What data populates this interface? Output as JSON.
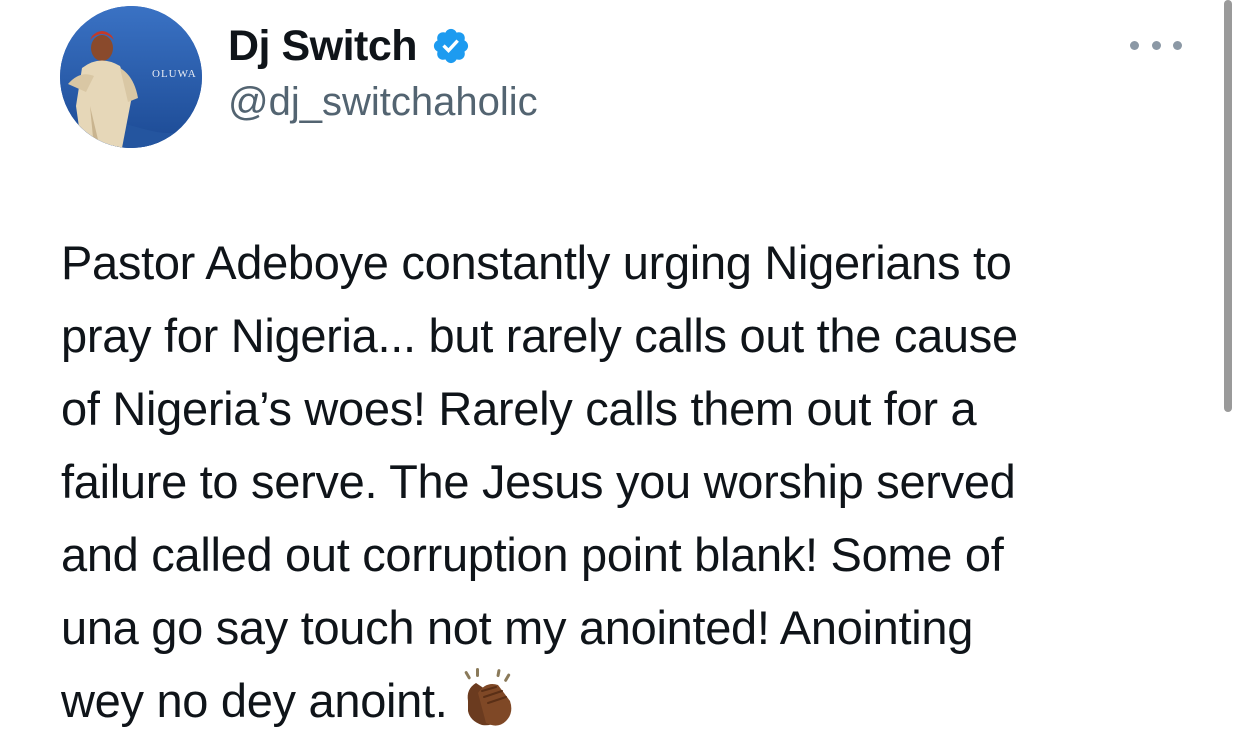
{
  "author": {
    "display_name": "Dj Switch",
    "handle": "@dj_switchaholic",
    "verified": true,
    "avatar_text": "OLUWA"
  },
  "menu": {
    "icon": "more-horizontal-icon"
  },
  "tweet": {
    "lines": [
      "Pastor Adeboye constantly urging Nigerians to",
      "pray for Nigeria...  but rarely calls out the cause",
      "of Nigeria’s woes! Rarely calls them out for a",
      "failure to serve. The Jesus you worship served",
      "and called out corruption point blank! Some of",
      "una go say touch not my anointed! Anointing",
      "wey no dey anoint."
    ],
    "emoji": "clapping-hands-icon"
  },
  "colors": {
    "text": "#0f1419",
    "secondary": "#536471",
    "verified": "#1d9bf0"
  }
}
